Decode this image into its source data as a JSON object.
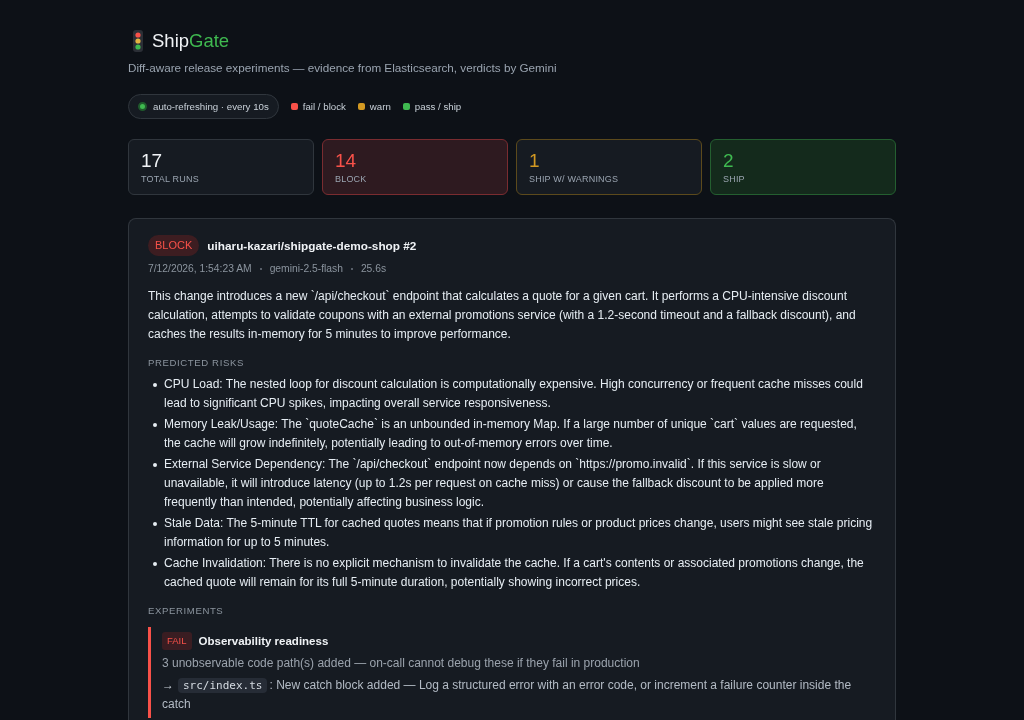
{
  "header": {
    "title": "Ship",
    "title_accent": "Gate",
    "subtitle": "Diff-aware release experiments — evidence from Elasticsearch, verdicts by Gemini"
  },
  "legend": {
    "refresh": "auto-refreshing · every 10s",
    "items": [
      {
        "label": "fail / block",
        "color": "#f85149"
      },
      {
        "label": "warn",
        "color": "#d29922"
      },
      {
        "label": "pass / ship",
        "color": "#3fb950"
      }
    ]
  },
  "stats": [
    {
      "value": "17",
      "label": "TOTAL RUNS",
      "kind": "total"
    },
    {
      "value": "14",
      "label": "BLOCK",
      "kind": "block"
    },
    {
      "value": "1",
      "label": "SHIP W/ WARNINGS",
      "kind": "warn"
    },
    {
      "value": "2",
      "label": "SHIP",
      "kind": "ship"
    }
  ],
  "run": {
    "verdict": {
      "label": "BLOCK",
      "kind": "block"
    },
    "repo": "uiharu-kazari/shipgate-demo-shop #2",
    "meta": [
      "7/12/2026, 1:54:23 AM",
      "gemini-2.5-flash",
      "25.6s"
    ],
    "summary": "This change introduces a new `/api/checkout` endpoint that calculates a quote for a given cart. It performs a CPU-intensive discount calculation, attempts to validate coupons with an external promotions service (with a 1.2-second timeout and a fallback discount), and caches the results in-memory for 5 minutes to improve performance.",
    "risks_heading": "PREDICTED RISKS",
    "risks": [
      "CPU Load: The nested loop for discount calculation is computationally expensive. High concurrency or frequent cache misses could lead to significant CPU spikes, impacting overall service responsiveness.",
      "Memory Leak/Usage: The `quoteCache` is an unbounded in-memory Map. If a large number of unique `cart` values are requested, the cache will grow indefinitely, potentially leading to out-of-memory errors over time.",
      "External Service Dependency: The `/api/checkout` endpoint now depends on `https://promo.invalid`. If this service is slow or unavailable, it will introduce latency (up to 1.2s per request on cache miss) or cause the fallback discount to be applied more frequently than intended, potentially affecting business logic.",
      "Stale Data: The 5-minute TTL for cached quotes means that if promotion rules or product prices change, users might see stale pricing information for up to 5 minutes.",
      "Cache Invalidation: There is no explicit mechanism to invalidate the cache. If a cart's contents or associated promotions change, the cached quote will remain for its full 5-minute duration, potentially showing incorrect prices."
    ],
    "experiments_heading": "EXPERIMENTS",
    "experiments": [
      {
        "status": {
          "label": "FAIL",
          "kind": "fail"
        },
        "name": "Observability readiness",
        "detail": "3 unobservable code path(s) added — on-call cannot debug these if they fail in production",
        "findings": [
          {
            "arrow": "→",
            "file": "src/index.ts",
            "text": ": New catch block added — Log a structured error with an error code, or increment a failure counter inside the catch"
          }
        ]
      }
    ]
  }
}
